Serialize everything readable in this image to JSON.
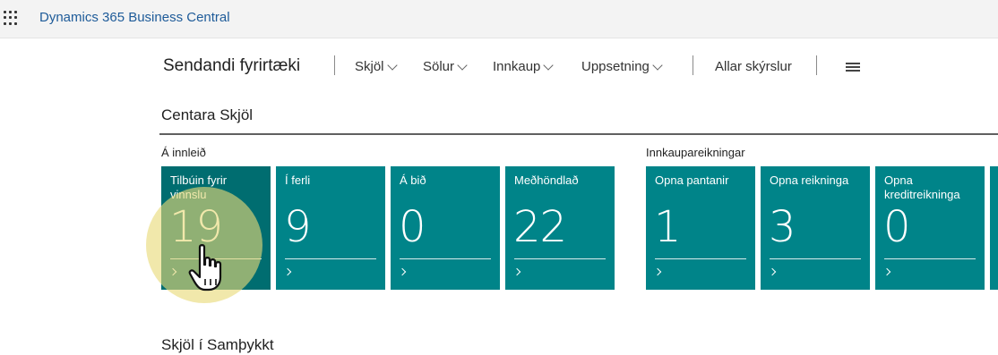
{
  "topbar": {
    "app_title": "Dynamics 365 Business Central",
    "app_launcher_icon": "waffle-icon"
  },
  "nav": {
    "company": "Sendandi fyrirtæki",
    "items": [
      {
        "label": "Skjöl",
        "has_dropdown": true
      },
      {
        "label": "Sölur",
        "has_dropdown": true
      },
      {
        "label": "Innkaup",
        "has_dropdown": true
      },
      {
        "label": "Uppsetning",
        "has_dropdown": true
      }
    ],
    "all_reports": "Allar skýrslur",
    "menu_icon": "hamburger-icon"
  },
  "section": {
    "title": "Centara Skjöl",
    "groups": [
      {
        "label": "Á innleið",
        "tiles": [
          {
            "label": "Tilbúin fyrir vinnslu",
            "value": "19"
          },
          {
            "label": "Í ferli",
            "value": "9"
          },
          {
            "label": "Á bið",
            "value": "0"
          },
          {
            "label": "Meðhöndlað",
            "value": "22"
          }
        ]
      },
      {
        "label": "Innkaupareikningar",
        "tiles": [
          {
            "label": "Opna pantanir",
            "value": "1"
          },
          {
            "label": "Opna reikninga",
            "value": "3"
          },
          {
            "label": "Opna kreditreikninga",
            "value": "0"
          }
        ]
      }
    ]
  },
  "section2": {
    "title": "Skjöl í Samþykkt"
  },
  "colors": {
    "tile": "#008489",
    "tile_selected": "#006d70",
    "brand_link": "#1e5b99",
    "highlight": "#e8da78"
  }
}
